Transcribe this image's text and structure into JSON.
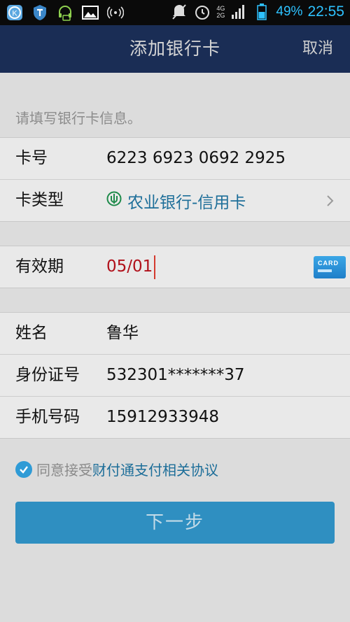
{
  "statusbar": {
    "battery": "49%",
    "time": "22:55",
    "network_a": "4G",
    "network_b": "2G"
  },
  "header": {
    "title": "添加银行卡",
    "cancel_label": "取消"
  },
  "hint": "请填写银行卡信息。",
  "card": {
    "number_label": "卡号",
    "number_value": "6223 6923 0692 2925",
    "type_label": "卡类型",
    "type_value": "农业银行-信用卡"
  },
  "expiry": {
    "label": "有效期",
    "value": "05/01",
    "card_icon_text": "CARD"
  },
  "personal": {
    "name_label": "姓名",
    "name_value": "鲁华",
    "id_label": "身份证号",
    "id_value": "532301*******37",
    "phone_label": "手机号码",
    "phone_value": "15912933948"
  },
  "agreement": {
    "prefix": "同意接受",
    "link": "财付通支付相关协议",
    "checked": true
  },
  "next_button_label": "下一步"
}
